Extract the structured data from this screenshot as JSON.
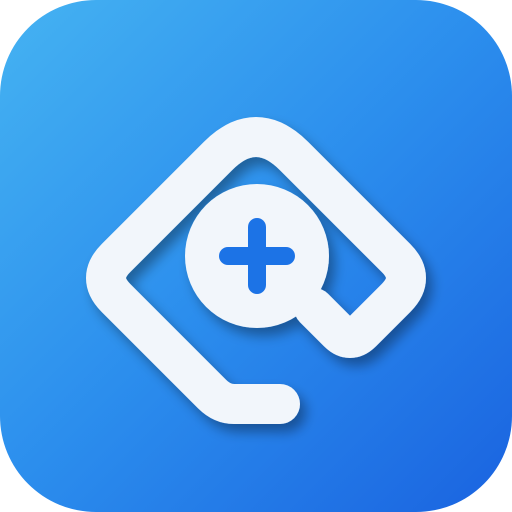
{
  "icon": {
    "name": "zoom-in-diamond-app-icon",
    "colors": {
      "gradient_start": "#45b3f2",
      "gradient_mid": "#2b8ded",
      "gradient_end": "#1a63e0",
      "glyph": "#f2f6fb",
      "shadow": "#0b3f9e"
    }
  }
}
